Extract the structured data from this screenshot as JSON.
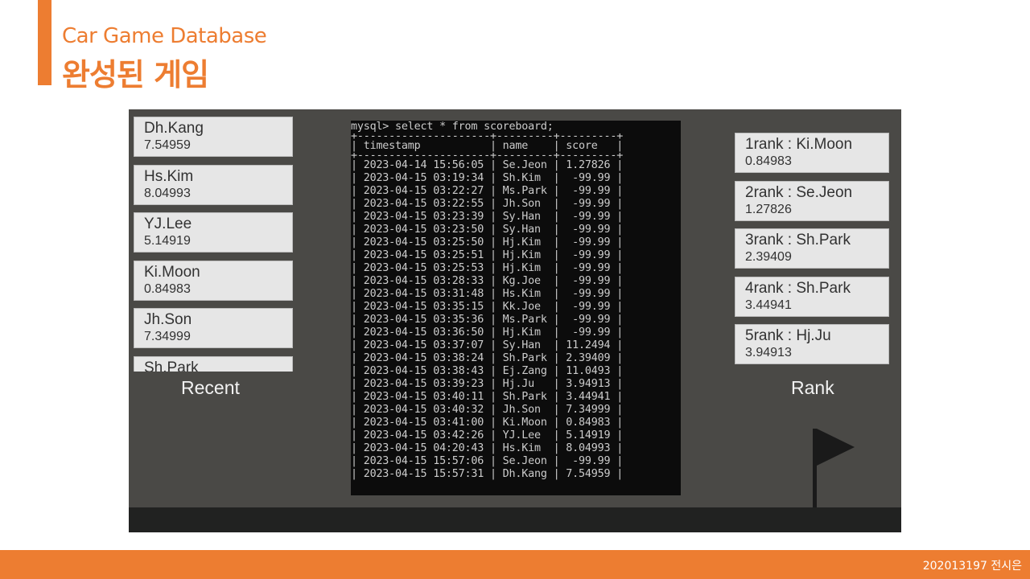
{
  "header": {
    "subtitle": "Car Game Database",
    "title": "완성된 게임"
  },
  "recent": {
    "label": "Recent",
    "items": [
      {
        "name": "Dh.Kang",
        "score": "7.54959"
      },
      {
        "name": "Hs.Kim",
        "score": "8.04993"
      },
      {
        "name": "YJ.Lee",
        "score": "5.14919"
      },
      {
        "name": "Ki.Moon",
        "score": "0.84983"
      },
      {
        "name": "Jh.Son",
        "score": "7.34999"
      },
      {
        "name": "Sh.Park",
        "score": ""
      }
    ]
  },
  "rank": {
    "label": "Rank",
    "items": [
      {
        "title": "1rank : Ki.Moon",
        "score": "0.84983"
      },
      {
        "title": "2rank : Se.Jeon",
        "score": "1.27826"
      },
      {
        "title": "3rank : Sh.Park",
        "score": "2.39409"
      },
      {
        "title": "4rank : Sh.Park",
        "score": "3.44941"
      },
      {
        "title": "5rank : Hj.Ju",
        "score": "3.94913"
      }
    ]
  },
  "console": {
    "command": "mysql> select * from scoreboard;",
    "separator": "+---------------------+---------+---------+",
    "header_row": "| timestamp           | name    | score   |",
    "rows": [
      "| 2023-04-14 15:56:05 | Se.Jeon | 1.27826 |",
      "| 2023-04-15 03:19:34 | Sh.Kim  |  -99.99 |",
      "| 2023-04-15 03:22:27 | Ms.Park |  -99.99 |",
      "| 2023-04-15 03:22:55 | Jh.Son  |  -99.99 |",
      "| 2023-04-15 03:23:39 | Sy.Han  |  -99.99 |",
      "| 2023-04-15 03:23:50 | Sy.Han  |  -99.99 |",
      "| 2023-04-15 03:25:50 | Hj.Kim  |  -99.99 |",
      "| 2023-04-15 03:25:51 | Hj.Kim  |  -99.99 |",
      "| 2023-04-15 03:25:53 | Hj.Kim  |  -99.99 |",
      "| 2023-04-15 03:28:33 | Kg.Joe  |  -99.99 |",
      "| 2023-04-15 03:31:48 | Hs.Kim  |  -99.99 |",
      "| 2023-04-15 03:35:15 | Kk.Joe  |  -99.99 |",
      "| 2023-04-15 03:35:36 | Ms.Park |  -99.99 |",
      "| 2023-04-15 03:36:50 | Hj.Kim  |  -99.99 |",
      "| 2023-04-15 03:37:07 | Sy.Han  | 11.2494 |",
      "| 2023-04-15 03:38:24 | Sh.Park | 2.39409 |",
      "| 2023-04-15 03:38:43 | Ej.Zang | 11.0493 |",
      "| 2023-04-15 03:39:23 | Hj.Ju   | 3.94913 |",
      "| 2023-04-15 03:40:11 | Sh.Park | 3.44941 |",
      "| 2023-04-15 03:40:32 | Jh.Son  | 7.34999 |",
      "| 2023-04-15 03:41:00 | Ki.Moon | 0.84983 |",
      "| 2023-04-15 03:42:26 | YJ.Lee  | 5.14919 |",
      "| 2023-04-15 04:20:43 | Hs.Kim  | 8.04993 |",
      "| 2023-04-15 15:57:06 | Se.Jeon |  -99.99 |",
      "| 2023-04-15 15:57:31 | Dh.Kang | 7.54959 |"
    ]
  },
  "icons": {
    "flag": "flag-icon"
  },
  "colors": {
    "accent": "#ed7d31",
    "game_bg": "#4a4946",
    "ground": "#212221",
    "card_bg": "#e6e6e6",
    "console_bg": "#0c0c0c"
  },
  "footer": {
    "text": "202013197 전시은"
  }
}
